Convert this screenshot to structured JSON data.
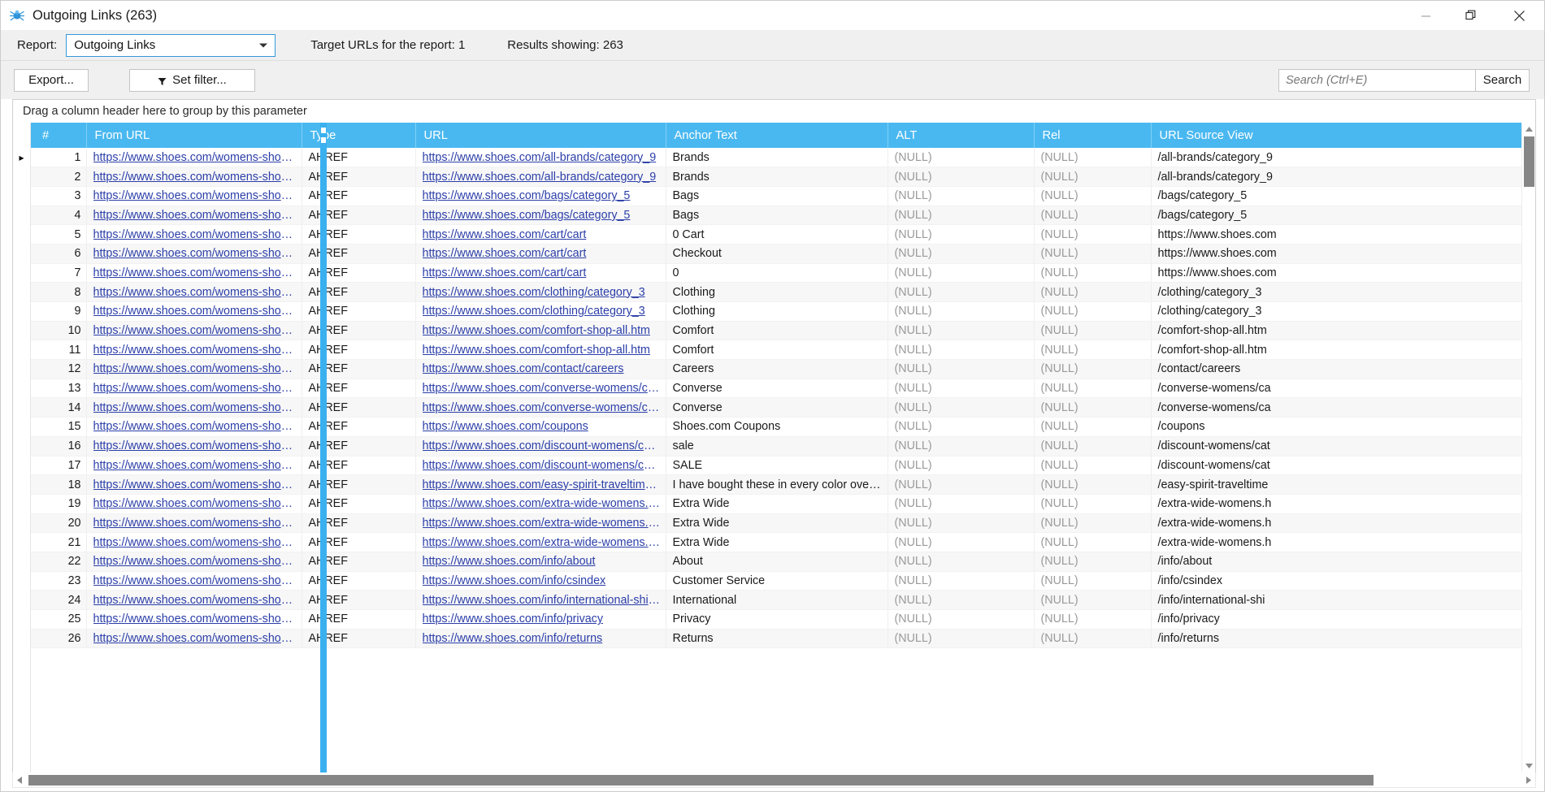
{
  "window": {
    "title": "Outgoing Links (263)",
    "icon": "spider-icon",
    "controls": {
      "minimize": "minimize-icon",
      "maximize": "restore-icon",
      "close": "close-icon"
    }
  },
  "report_bar": {
    "label": "Report:",
    "selected": "Outgoing Links",
    "target_urls": "Target URLs for the report: 1",
    "results_showing": "Results showing: 263"
  },
  "toolbar": {
    "export_label": "Export...",
    "set_filter_label": "Set filter...",
    "search_placeholder": "Search (Ctrl+E)",
    "search_value": "",
    "search_button": "Search"
  },
  "grid": {
    "group_hint": "Drag a column header here to group by this parameter",
    "columns": [
      "#",
      "From URL",
      "Type",
      "URL",
      "Anchor Text",
      "ALT",
      "Rel",
      "URL Source View"
    ],
    "rows": [
      {
        "n": "1",
        "from": "https://www.shoes.com/womens-shoes/c...",
        "type": "AHREF",
        "url": "https://www.shoes.com/all-brands/category_9",
        "anchor": "Brands",
        "alt": "(NULL)",
        "rel": "(NULL)",
        "src": "/all-brands/category_9"
      },
      {
        "n": "2",
        "from": "https://www.shoes.com/womens-shoes/c...",
        "type": "AHREF",
        "url": "https://www.shoes.com/all-brands/category_9",
        "anchor": "Brands",
        "alt": "(NULL)",
        "rel": "(NULL)",
        "src": "/all-brands/category_9"
      },
      {
        "n": "3",
        "from": "https://www.shoes.com/womens-shoes/c...",
        "type": "AHREF",
        "url": "https://www.shoes.com/bags/category_5",
        "anchor": "Bags",
        "alt": "(NULL)",
        "rel": "(NULL)",
        "src": "/bags/category_5"
      },
      {
        "n": "4",
        "from": "https://www.shoes.com/womens-shoes/c...",
        "type": "AHREF",
        "url": "https://www.shoes.com/bags/category_5",
        "anchor": "Bags",
        "alt": "(NULL)",
        "rel": "(NULL)",
        "src": "/bags/category_5"
      },
      {
        "n": "5",
        "from": "https://www.shoes.com/womens-shoes/c...",
        "type": "AHREF",
        "url": "https://www.shoes.com/cart/cart",
        "anchor": "0 Cart",
        "alt": "(NULL)",
        "rel": "(NULL)",
        "src": "https://www.shoes.com"
      },
      {
        "n": "6",
        "from": "https://www.shoes.com/womens-shoes/c...",
        "type": "AHREF",
        "url": "https://www.shoes.com/cart/cart",
        "anchor": "Checkout",
        "alt": "(NULL)",
        "rel": "(NULL)",
        "src": "https://www.shoes.com"
      },
      {
        "n": "7",
        "from": "https://www.shoes.com/womens-shoes/c...",
        "type": "AHREF",
        "url": "https://www.shoes.com/cart/cart",
        "anchor": "0",
        "alt": "(NULL)",
        "rel": "(NULL)",
        "src": "https://www.shoes.com"
      },
      {
        "n": "8",
        "from": "https://www.shoes.com/womens-shoes/c...",
        "type": "AHREF",
        "url": "https://www.shoes.com/clothing/category_3",
        "anchor": "Clothing",
        "alt": "(NULL)",
        "rel": "(NULL)",
        "src": "/clothing/category_3"
      },
      {
        "n": "9",
        "from": "https://www.shoes.com/womens-shoes/c...",
        "type": "AHREF",
        "url": "https://www.shoes.com/clothing/category_3",
        "anchor": "Clothing",
        "alt": "(NULL)",
        "rel": "(NULL)",
        "src": "/clothing/category_3"
      },
      {
        "n": "10",
        "from": "https://www.shoes.com/womens-shoes/c...",
        "type": "AHREF",
        "url": "https://www.shoes.com/comfort-shop-all.htm",
        "anchor": "Comfort",
        "alt": "(NULL)",
        "rel": "(NULL)",
        "src": "/comfort-shop-all.htm"
      },
      {
        "n": "11",
        "from": "https://www.shoes.com/womens-shoes/c...",
        "type": "AHREF",
        "url": "https://www.shoes.com/comfort-shop-all.htm",
        "anchor": "Comfort",
        "alt": "(NULL)",
        "rel": "(NULL)",
        "src": "/comfort-shop-all.htm"
      },
      {
        "n": "12",
        "from": "https://www.shoes.com/womens-shoes/c...",
        "type": "AHREF",
        "url": "https://www.shoes.com/contact/careers",
        "anchor": "Careers",
        "alt": "(NULL)",
        "rel": "(NULL)",
        "src": "/contact/careers"
      },
      {
        "n": "13",
        "from": "https://www.shoes.com/womens-shoes/c...",
        "type": "AHREF",
        "url": "https://www.shoes.com/converse-womens/categ...",
        "anchor": "Converse",
        "alt": "(NULL)",
        "rel": "(NULL)",
        "src": "/converse-womens/ca"
      },
      {
        "n": "14",
        "from": "https://www.shoes.com/womens-shoes/c...",
        "type": "AHREF",
        "url": "https://www.shoes.com/converse-womens/categ...",
        "anchor": "Converse",
        "alt": "(NULL)",
        "rel": "(NULL)",
        "src": "/converse-womens/ca"
      },
      {
        "n": "15",
        "from": "https://www.shoes.com/womens-shoes/c...",
        "type": "AHREF",
        "url": "https://www.shoes.com/coupons",
        "anchor": "Shoes.com Coupons",
        "alt": "(NULL)",
        "rel": "(NULL)",
        "src": "/coupons"
      },
      {
        "n": "16",
        "from": "https://www.shoes.com/womens-shoes/c...",
        "type": "AHREF",
        "url": "https://www.shoes.com/discount-womens/categ...",
        "anchor": "sale",
        "alt": "(NULL)",
        "rel": "(NULL)",
        "src": "/discount-womens/cat"
      },
      {
        "n": "17",
        "from": "https://www.shoes.com/womens-shoes/c...",
        "type": "AHREF",
        "url": "https://www.shoes.com/discount-womens/categ...",
        "anchor": "SALE",
        "alt": "(NULL)",
        "rel": "(NULL)",
        "src": "/discount-womens/cat"
      },
      {
        "n": "18",
        "from": "https://www.shoes.com/womens-shoes/c...",
        "type": "AHREF",
        "url": "https://www.shoes.com/easy-spirit-traveltime-sli...",
        "anchor": "I have bought these in every color over the y...",
        "alt": "(NULL)",
        "rel": "(NULL)",
        "src": "/easy-spirit-traveltime"
      },
      {
        "n": "19",
        "from": "https://www.shoes.com/womens-shoes/c...",
        "type": "AHREF",
        "url": "https://www.shoes.com/extra-wide-womens.htm",
        "anchor": "Extra Wide",
        "alt": "(NULL)",
        "rel": "(NULL)",
        "src": "/extra-wide-womens.h"
      },
      {
        "n": "20",
        "from": "https://www.shoes.com/womens-shoes/c...",
        "type": "AHREF",
        "url": "https://www.shoes.com/extra-wide-womens.htm",
        "anchor": "Extra Wide",
        "alt": "(NULL)",
        "rel": "(NULL)",
        "src": "/extra-wide-womens.h"
      },
      {
        "n": "21",
        "from": "https://www.shoes.com/womens-shoes/c...",
        "type": "AHREF",
        "url": "https://www.shoes.com/extra-wide-womens.htm",
        "anchor": "Extra Wide",
        "alt": "(NULL)",
        "rel": "(NULL)",
        "src": "/extra-wide-womens.h"
      },
      {
        "n": "22",
        "from": "https://www.shoes.com/womens-shoes/c...",
        "type": "AHREF",
        "url": "https://www.shoes.com/info/about",
        "anchor": "About",
        "alt": "(NULL)",
        "rel": "(NULL)",
        "src": "/info/about"
      },
      {
        "n": "23",
        "from": "https://www.shoes.com/womens-shoes/c...",
        "type": "AHREF",
        "url": "https://www.shoes.com/info/csindex",
        "anchor": "Customer Service",
        "alt": "(NULL)",
        "rel": "(NULL)",
        "src": "/info/csindex"
      },
      {
        "n": "24",
        "from": "https://www.shoes.com/womens-shoes/c...",
        "type": "AHREF",
        "url": "https://www.shoes.com/info/international-shippi...",
        "anchor": "International",
        "alt": "(NULL)",
        "rel": "(NULL)",
        "src": "/info/international-shi"
      },
      {
        "n": "25",
        "from": "https://www.shoes.com/womens-shoes/c...",
        "type": "AHREF",
        "url": "https://www.shoes.com/info/privacy",
        "anchor": "Privacy",
        "alt": "(NULL)",
        "rel": "(NULL)",
        "src": "/info/privacy"
      },
      {
        "n": "26",
        "from": "https://www.shoes.com/womens-shoes/c...",
        "type": "AHREF",
        "url": "https://www.shoes.com/info/returns",
        "anchor": "Returns",
        "alt": "(NULL)",
        "rel": "(NULL)",
        "src": "/info/returns"
      }
    ],
    "row_indicator": "▸"
  },
  "colors": {
    "header_blue": "#4ab8f0",
    "link_blue": "#2b3ea8",
    "chrome_gray": "#f0f0f0",
    "accent_focus": "#3399dd"
  },
  "scroll": {
    "up_arrow": "▲",
    "down_arrow": "▼",
    "left_arrow": "◀",
    "right_arrow": "▶"
  }
}
